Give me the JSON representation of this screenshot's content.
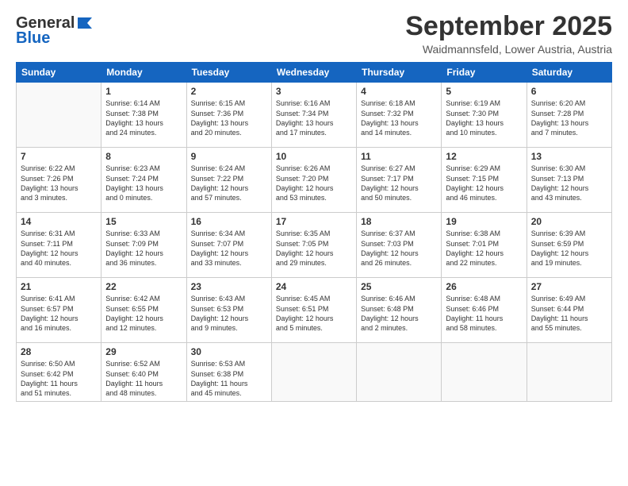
{
  "logo": {
    "general": "General",
    "blue": "Blue"
  },
  "header": {
    "month": "September 2025",
    "location": "Waidmannsfeld, Lower Austria, Austria"
  },
  "weekdays": [
    "Sunday",
    "Monday",
    "Tuesday",
    "Wednesday",
    "Thursday",
    "Friday",
    "Saturday"
  ],
  "weeks": [
    [
      {
        "day": "",
        "info": ""
      },
      {
        "day": "1",
        "info": "Sunrise: 6:14 AM\nSunset: 7:38 PM\nDaylight: 13 hours\nand 24 minutes."
      },
      {
        "day": "2",
        "info": "Sunrise: 6:15 AM\nSunset: 7:36 PM\nDaylight: 13 hours\nand 20 minutes."
      },
      {
        "day": "3",
        "info": "Sunrise: 6:16 AM\nSunset: 7:34 PM\nDaylight: 13 hours\nand 17 minutes."
      },
      {
        "day": "4",
        "info": "Sunrise: 6:18 AM\nSunset: 7:32 PM\nDaylight: 13 hours\nand 14 minutes."
      },
      {
        "day": "5",
        "info": "Sunrise: 6:19 AM\nSunset: 7:30 PM\nDaylight: 13 hours\nand 10 minutes."
      },
      {
        "day": "6",
        "info": "Sunrise: 6:20 AM\nSunset: 7:28 PM\nDaylight: 13 hours\nand 7 minutes."
      }
    ],
    [
      {
        "day": "7",
        "info": "Sunrise: 6:22 AM\nSunset: 7:26 PM\nDaylight: 13 hours\nand 3 minutes."
      },
      {
        "day": "8",
        "info": "Sunrise: 6:23 AM\nSunset: 7:24 PM\nDaylight: 13 hours\nand 0 minutes."
      },
      {
        "day": "9",
        "info": "Sunrise: 6:24 AM\nSunset: 7:22 PM\nDaylight: 12 hours\nand 57 minutes."
      },
      {
        "day": "10",
        "info": "Sunrise: 6:26 AM\nSunset: 7:20 PM\nDaylight: 12 hours\nand 53 minutes."
      },
      {
        "day": "11",
        "info": "Sunrise: 6:27 AM\nSunset: 7:17 PM\nDaylight: 12 hours\nand 50 minutes."
      },
      {
        "day": "12",
        "info": "Sunrise: 6:29 AM\nSunset: 7:15 PM\nDaylight: 12 hours\nand 46 minutes."
      },
      {
        "day": "13",
        "info": "Sunrise: 6:30 AM\nSunset: 7:13 PM\nDaylight: 12 hours\nand 43 minutes."
      }
    ],
    [
      {
        "day": "14",
        "info": "Sunrise: 6:31 AM\nSunset: 7:11 PM\nDaylight: 12 hours\nand 40 minutes."
      },
      {
        "day": "15",
        "info": "Sunrise: 6:33 AM\nSunset: 7:09 PM\nDaylight: 12 hours\nand 36 minutes."
      },
      {
        "day": "16",
        "info": "Sunrise: 6:34 AM\nSunset: 7:07 PM\nDaylight: 12 hours\nand 33 minutes."
      },
      {
        "day": "17",
        "info": "Sunrise: 6:35 AM\nSunset: 7:05 PM\nDaylight: 12 hours\nand 29 minutes."
      },
      {
        "day": "18",
        "info": "Sunrise: 6:37 AM\nSunset: 7:03 PM\nDaylight: 12 hours\nand 26 minutes."
      },
      {
        "day": "19",
        "info": "Sunrise: 6:38 AM\nSunset: 7:01 PM\nDaylight: 12 hours\nand 22 minutes."
      },
      {
        "day": "20",
        "info": "Sunrise: 6:39 AM\nSunset: 6:59 PM\nDaylight: 12 hours\nand 19 minutes."
      }
    ],
    [
      {
        "day": "21",
        "info": "Sunrise: 6:41 AM\nSunset: 6:57 PM\nDaylight: 12 hours\nand 16 minutes."
      },
      {
        "day": "22",
        "info": "Sunrise: 6:42 AM\nSunset: 6:55 PM\nDaylight: 12 hours\nand 12 minutes."
      },
      {
        "day": "23",
        "info": "Sunrise: 6:43 AM\nSunset: 6:53 PM\nDaylight: 12 hours\nand 9 minutes."
      },
      {
        "day": "24",
        "info": "Sunrise: 6:45 AM\nSunset: 6:51 PM\nDaylight: 12 hours\nand 5 minutes."
      },
      {
        "day": "25",
        "info": "Sunrise: 6:46 AM\nSunset: 6:48 PM\nDaylight: 12 hours\nand 2 minutes."
      },
      {
        "day": "26",
        "info": "Sunrise: 6:48 AM\nSunset: 6:46 PM\nDaylight: 11 hours\nand 58 minutes."
      },
      {
        "day": "27",
        "info": "Sunrise: 6:49 AM\nSunset: 6:44 PM\nDaylight: 11 hours\nand 55 minutes."
      }
    ],
    [
      {
        "day": "28",
        "info": "Sunrise: 6:50 AM\nSunset: 6:42 PM\nDaylight: 11 hours\nand 51 minutes."
      },
      {
        "day": "29",
        "info": "Sunrise: 6:52 AM\nSunset: 6:40 PM\nDaylight: 11 hours\nand 48 minutes."
      },
      {
        "day": "30",
        "info": "Sunrise: 6:53 AM\nSunset: 6:38 PM\nDaylight: 11 hours\nand 45 minutes."
      },
      {
        "day": "",
        "info": ""
      },
      {
        "day": "",
        "info": ""
      },
      {
        "day": "",
        "info": ""
      },
      {
        "day": "",
        "info": ""
      }
    ]
  ]
}
